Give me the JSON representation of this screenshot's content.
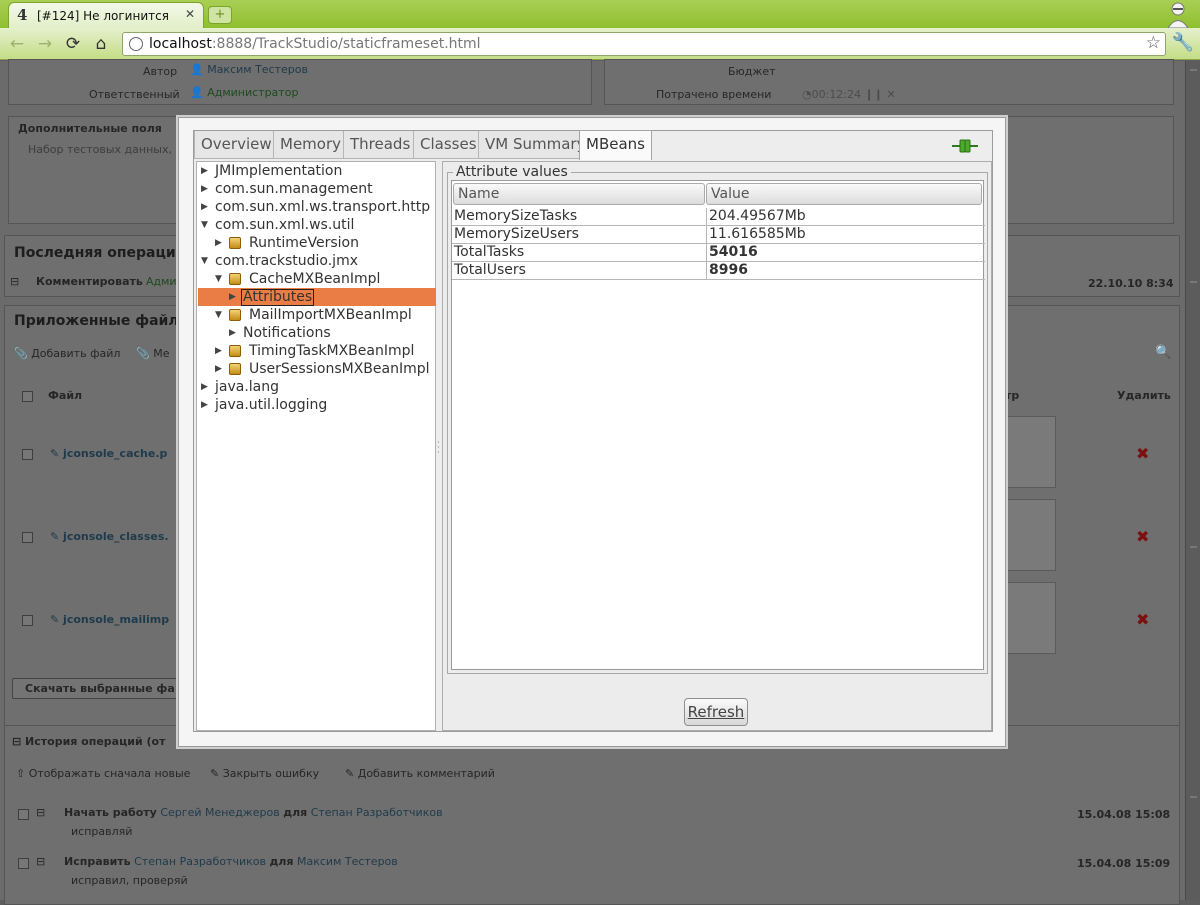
{
  "browser": {
    "tab_title": "[#124] Не логинится",
    "tab_close": "✕",
    "url_host": "localhost",
    "url_rest": ":8888/TrackStudio/staticframeset.html"
  },
  "page": {
    "author_label": "Автор",
    "author_value": "Максим Тестеров",
    "responsible_label": "Ответственный",
    "responsible_value": "Администратор",
    "budget_label": "Бюджет",
    "time_spent_label": "Потрачено времени",
    "time_spent_value": "00:12:24",
    "extra_fields_title": "Дополнительные поля",
    "extra_fields_text": "Набор тестовых данных,",
    "last_op_title": "Последняя операци",
    "last_op_action": "Комментировать",
    "last_op_user": "Адми",
    "last_op_date": "22.10.10 8:34",
    "attached_title": "Приложенные файл",
    "add_file": "Добавить файл",
    "add_file2": "Ме",
    "col_file": "Файл",
    "col_preview": "тр",
    "col_delete": "Удалить",
    "files": [
      "jconsole_cache.p",
      "jconsole_classes.",
      "jconsole_mailimp"
    ],
    "download_btn": "Скачать выбранные фа",
    "history_title": "История операций (от",
    "history_tools": [
      "Отображать сначала новые",
      "Закрыть ошибку",
      "Добавить комментарий"
    ],
    "history": [
      {
        "action": "Начать работу",
        "from": "Сергей Менеджеров",
        "for": "для",
        "to": "Степан Разработчиков",
        "date": "15.04.08 15:08",
        "comment": "исправляй"
      },
      {
        "action": "Исправить",
        "from": "Степан Разработчиков",
        "for": "для",
        "to": "Максим Тестеров",
        "date": "15.04.08 15:09",
        "comment": "исправил, проверяй"
      }
    ]
  },
  "jconsole": {
    "tabs": [
      "Overview",
      "Memory",
      "Threads",
      "Classes",
      "VM Summary",
      "MBeans"
    ],
    "active_tab": "MBeans",
    "tree": [
      "JMImplementation",
      "com.sun.management",
      "com.sun.xml.ws.transport.http",
      "com.sun.xml.ws.util",
      "RuntimeVersion",
      "com.trackstudio.jmx",
      "CacheMXBeanImpl",
      "Attributes",
      "MailImportMXBeanImpl",
      "Notifications",
      "TimingTaskMXBeanImpl",
      "UserSessionsMXBeanImpl",
      "java.lang",
      "java.util.logging"
    ],
    "attr_legend": "Attribute values",
    "columns": [
      "Name",
      "Value"
    ],
    "rows": [
      {
        "name": "MemorySizeTasks",
        "value": "204.49567Mb"
      },
      {
        "name": "MemorySizeUsers",
        "value": "11.616585Mb"
      },
      {
        "name": "TotalTasks",
        "value": "54016"
      },
      {
        "name": "TotalUsers",
        "value": "8996"
      }
    ],
    "refresh_label": "Refresh"
  }
}
